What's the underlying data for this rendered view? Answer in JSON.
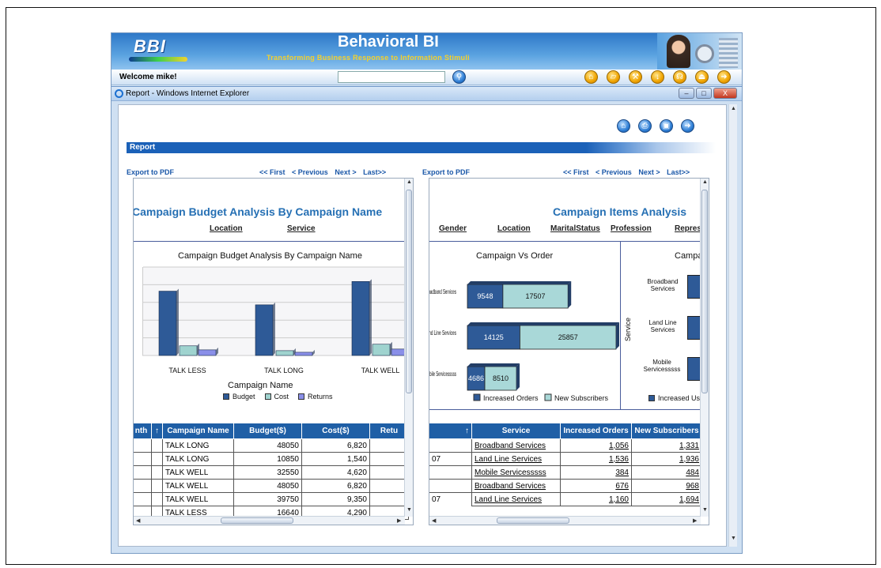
{
  "banner": {
    "logo": "BBI",
    "title": "Behavioral BI",
    "subtitle": "Transforming Business Response to Information Stimuli"
  },
  "navbar": {
    "welcome": "Welcome mike!",
    "search_value": "",
    "icons": [
      "home-icon",
      "gift-icon",
      "tools-icon",
      "download-icon",
      "headset-icon",
      "eject-icon",
      "logout-icon"
    ]
  },
  "ie": {
    "title": "Report - Windows Internet Explorer",
    "min": "–",
    "max": "□",
    "close": "X"
  },
  "report": {
    "toolbar_icons": [
      "home-icon",
      "print-icon",
      "save-icon",
      "forward-icon"
    ],
    "bar_label": "Report"
  },
  "left": {
    "export": "Export to PDF",
    "pager": [
      "<< First",
      "< Previous",
      "Next >",
      "Last>>"
    ],
    "title": "Campaign Budget Analysis By Campaign Name",
    "filters": [
      "Location",
      "Service"
    ],
    "chart_title": "Campaign Budget Analysis By Campaign Name",
    "xlabel": "Campaign Name",
    "table_headers": [
      "nth",
      "↑",
      "Campaign Name",
      "Budget($)",
      "Cost($)",
      "Retu"
    ],
    "rows": [
      {
        "name": "TALK LONG",
        "budget": "48050",
        "cost": "6,820"
      },
      {
        "name": "TALK LONG",
        "budget": "10850",
        "cost": "1,540"
      },
      {
        "name": "TALK WELL",
        "budget": "32550",
        "cost": "4,620"
      },
      {
        "name": "TALK WELL",
        "budget": "48050",
        "cost": "6,820"
      },
      {
        "name": "TALK WELL",
        "budget": "39750",
        "cost": "9,350"
      },
      {
        "name": "TALK LESS",
        "budget": "16640",
        "cost": "4,290"
      }
    ]
  },
  "right": {
    "export": "Export to PDF",
    "pager": [
      "<< First",
      "< Previous",
      "Next >",
      "Last>>"
    ],
    "title": "Campaign Items Analysis",
    "filters": [
      "Gender",
      "Location",
      "MaritalStatus",
      "Profession",
      "Repres"
    ],
    "chart_title": "Campaign Vs Order",
    "chart2_title": "Campa",
    "chart2_ylabel": "Service",
    "chart2_categories": [
      "Broadband Services",
      "Land Line Services",
      "Mobile Servicesssss"
    ],
    "chart2_legend": "Increased Us",
    "table_headers": [
      "↑",
      "Service",
      "Increased Orders",
      "New Subscribers"
    ],
    "rows": [
      {
        "month": "",
        "service": "Broadband Services",
        "orders": "1,056",
        "subs": "1,331"
      },
      {
        "month": "07",
        "service": "Land Line Services",
        "orders": "1,536",
        "subs": "1,936"
      },
      {
        "month": "",
        "service": "Mobile Servicesssss",
        "orders": "384",
        "subs": "484"
      },
      {
        "month": "",
        "service": "Broadband Services",
        "orders": "676",
        "subs": "968"
      },
      {
        "month": "07",
        "service": "Land Line Services",
        "orders": "1,160",
        "subs": "1,694"
      }
    ]
  },
  "chart_data": [
    {
      "type": "bar",
      "title": "Campaign Budget Analysis By Campaign Name",
      "xlabel": "Campaign Name",
      "ylabel": "",
      "categories": [
        "TALK LESS",
        "TALK LONG",
        "TALK WELL"
      ],
      "series": [
        {
          "name": "Budget",
          "color": "#2e5a97",
          "values": [
            80,
            63,
            92
          ]
        },
        {
          "name": "Cost",
          "color": "#9fd3cf",
          "values": [
            12,
            6,
            14
          ]
        },
        {
          "name": "Returns",
          "color": "#8a8fe8",
          "values": [
            7,
            4,
            8
          ]
        }
      ],
      "ylim": [
        0,
        110
      ],
      "grid": true,
      "legend": "bottom"
    },
    {
      "type": "bar",
      "orientation": "horizontal-stacked",
      "title": "Campaign Vs Order",
      "categories": [
        "Broadband Services",
        "Land Line Services",
        "Mobile Servicesssss"
      ],
      "series": [
        {
          "name": "Increased Orders",
          "color": "#2e5a97",
          "values": [
            9548,
            14125,
            4686
          ]
        },
        {
          "name": "New Subscribers",
          "color": "#a9d8d8",
          "values": [
            17507,
            25857,
            8510
          ]
        }
      ],
      "legend": "bottom"
    }
  ]
}
